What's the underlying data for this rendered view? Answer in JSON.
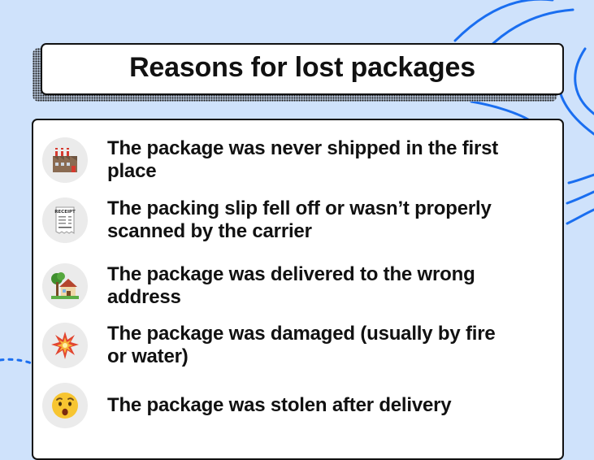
{
  "title": "Reasons for lost packages",
  "colors": {
    "background": "#cfe2fb",
    "accent_blue": "#1a6ef0",
    "border": "#111111",
    "panel": "#ffffff",
    "icon_bg": "#ebebeb"
  },
  "reasons": [
    {
      "icon": "factory-icon",
      "text": "The package was never shipped in the first place"
    },
    {
      "icon": "receipt-icon",
      "receipt_label": "RECEIPT",
      "text": "The packing slip fell off or wasn’t properly scanned by the carrier"
    },
    {
      "icon": "house-with-garden-icon",
      "text": "The package was delivered to the wrong address"
    },
    {
      "icon": "collision-icon",
      "text": "The package was damaged (usually by fire or water)"
    },
    {
      "icon": "anguished-face-icon",
      "text": "The package was stolen after delivery"
    }
  ]
}
